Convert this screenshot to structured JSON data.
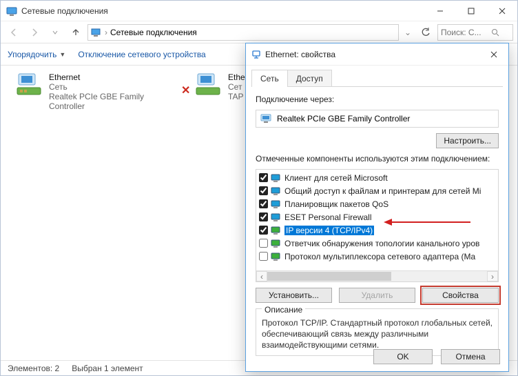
{
  "window": {
    "title": "Сетевые подключения",
    "breadcrumb": "Сетевые подключения",
    "search_placeholder": "Поиск: С..."
  },
  "cmdbar": {
    "organize": "Упорядочить",
    "disable": "Отключение сетевого устройства"
  },
  "connections": [
    {
      "name": "Ethernet",
      "network": "Сеть",
      "device": "Realtek PCIe GBE Family Controller"
    },
    {
      "name": "Ethe",
      "network": "Сет",
      "device": "TAP"
    }
  ],
  "statusbar": {
    "count": "Элементов: 2",
    "selected": "Выбран 1 элемент"
  },
  "dialog": {
    "title": "Ethernet: свойства",
    "tabs": {
      "network": "Сеть",
      "access": "Доступ"
    },
    "connect_label": "Подключение через:",
    "adapter": "Realtek PCIe GBE Family Controller",
    "configure": "Настроить...",
    "components_label": "Отмеченные компоненты используются этим подключением:",
    "components": [
      {
        "checked": true,
        "label": "Клиент для сетей Microsoft",
        "icon": "client"
      },
      {
        "checked": true,
        "label": "Общий доступ к файлам и принтерам для сетей Mi",
        "icon": "share"
      },
      {
        "checked": true,
        "label": "Планировщик пакетов QoS",
        "icon": "qos"
      },
      {
        "checked": true,
        "label": "ESET Personal Firewall",
        "icon": "eset"
      },
      {
        "checked": true,
        "label": "IP версии 4 (TCP/IPv4)",
        "icon": "proto",
        "selected": true
      },
      {
        "checked": false,
        "label": "Ответчик обнаружения топологии канального уров",
        "icon": "lltd"
      },
      {
        "checked": false,
        "label": "Протокол мультиплексора сетевого адаптера (Ma",
        "icon": "mux"
      }
    ],
    "install": "Установить...",
    "remove": "Удалить",
    "properties": "Свойства",
    "desc_title": "Описание",
    "desc_body": "Протокол TCP/IP. Стандартный протокол глобальных сетей, обеспечивающий связь между различными взаимодействующими сетями.",
    "ok": "OK",
    "cancel": "Отмена"
  }
}
